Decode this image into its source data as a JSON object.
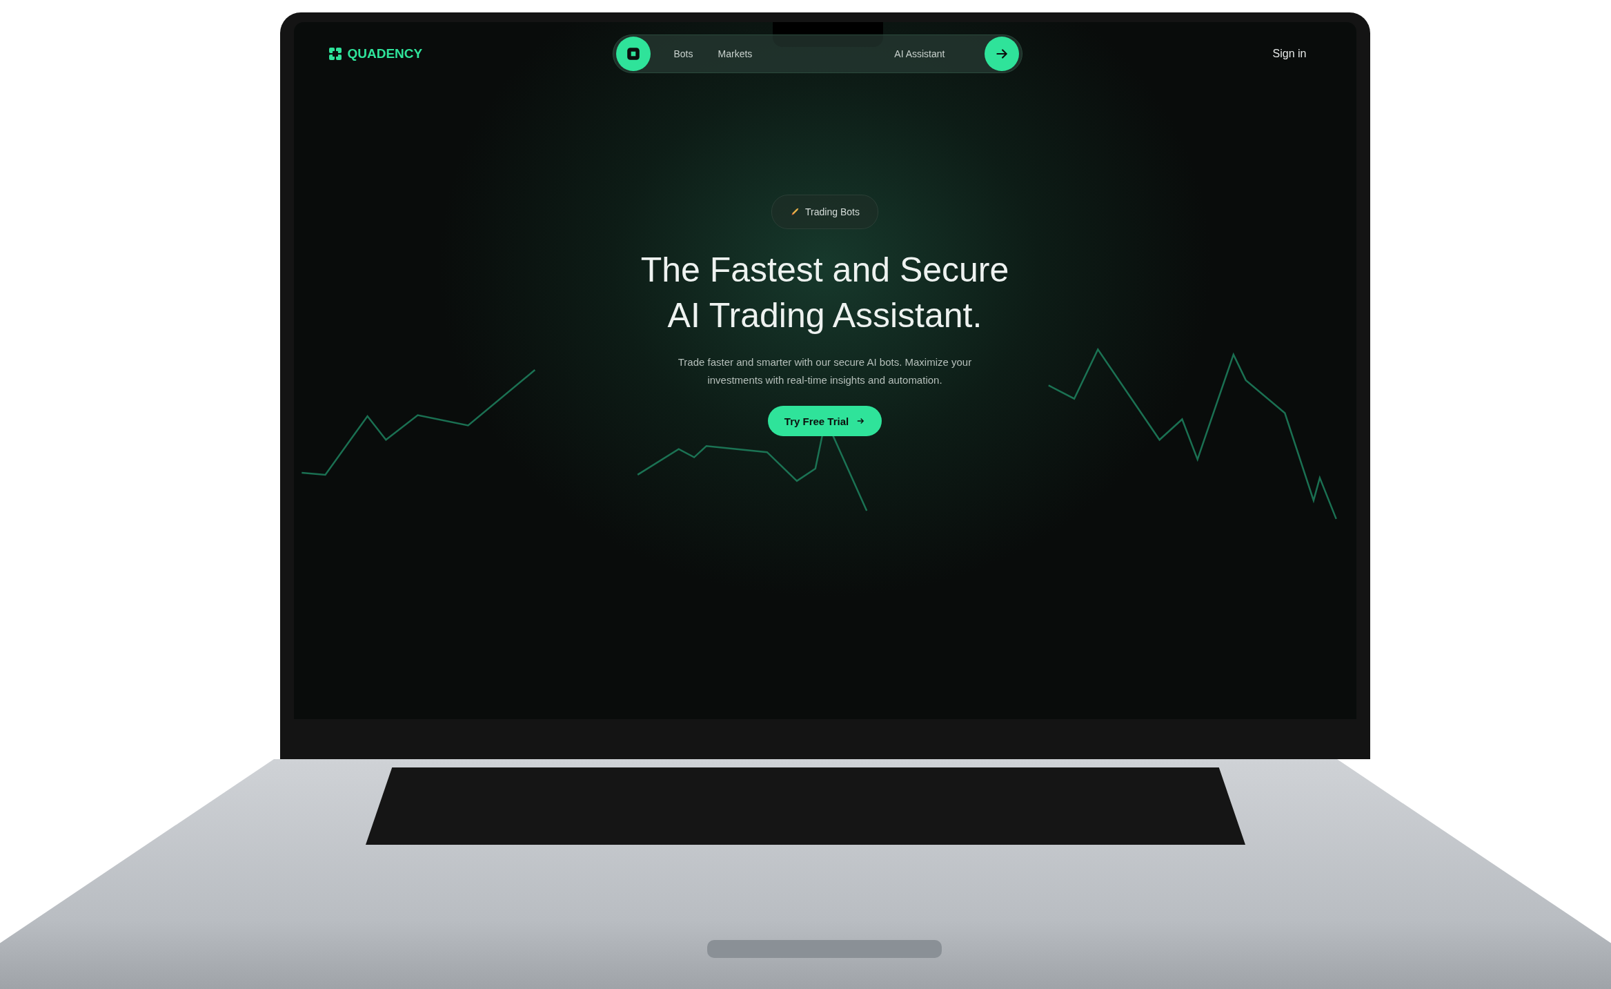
{
  "brand": {
    "name": "QUADENCY"
  },
  "nav": {
    "items": [
      {
        "label": "Bots"
      },
      {
        "label": "Markets"
      },
      {
        "label": "AI Assistant"
      }
    ]
  },
  "sign_in": "Sign in",
  "hero": {
    "badge": "Trading Bots",
    "title_lines": [
      "The Fastest and Secure",
      "AI Trading Assistant."
    ],
    "subtitle_lines": [
      "Trade faster and smarter with our secure AI bots. Maximize your",
      "investments with real-time insights and automation."
    ],
    "cta": "Try Free Trial"
  }
}
